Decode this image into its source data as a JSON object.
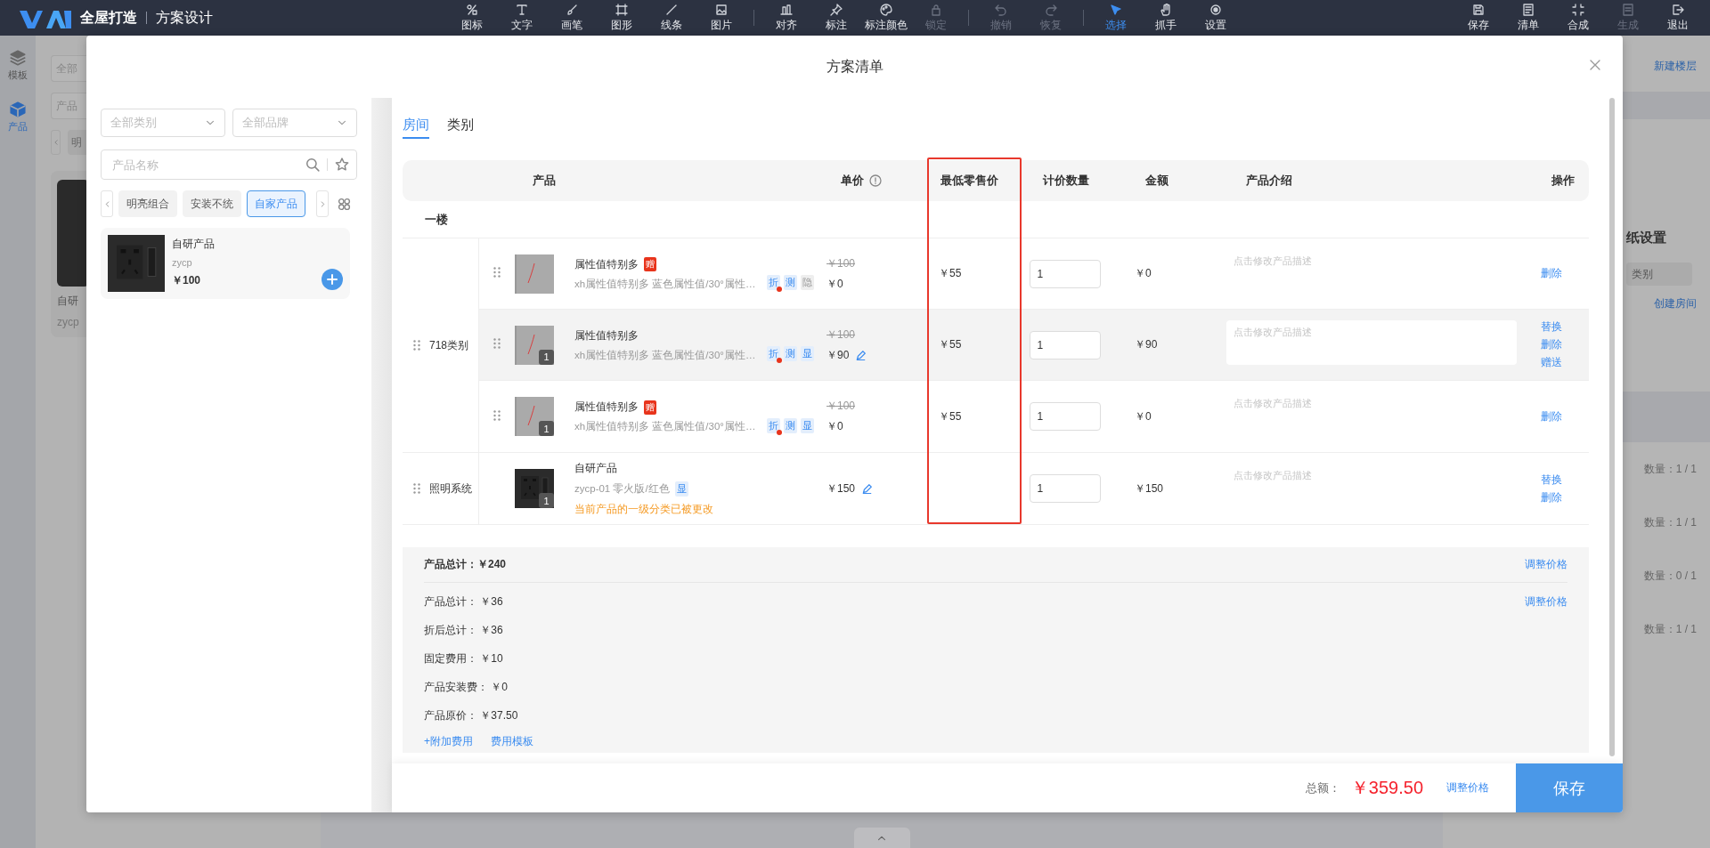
{
  "app_bar": {
    "brand": "全屋打造",
    "title": "方案设计",
    "tool_groups": [
      {
        "tools": [
          {
            "label": "图标",
            "disabled": false,
            "selected": false
          },
          {
            "label": "文字",
            "disabled": false,
            "selected": false
          },
          {
            "label": "画笔",
            "disabled": false,
            "selected": false
          },
          {
            "label": "图形",
            "disabled": false,
            "selected": false
          },
          {
            "label": "线条",
            "disabled": false,
            "selected": false
          },
          {
            "label": "图片",
            "disabled": false,
            "selected": false
          }
        ]
      },
      {
        "tools": [
          {
            "label": "对齐",
            "disabled": false,
            "selected": false
          },
          {
            "label": "标注",
            "disabled": false,
            "selected": false
          },
          {
            "label": "标注颜色",
            "disabled": false,
            "selected": false
          },
          {
            "label": "锁定",
            "disabled": true,
            "selected": false
          }
        ]
      },
      {
        "tools": [
          {
            "label": "撤销",
            "disabled": true,
            "selected": false
          },
          {
            "label": "恢复",
            "disabled": true,
            "selected": false
          }
        ]
      },
      {
        "tools": [
          {
            "label": "选择",
            "disabled": false,
            "selected": true
          },
          {
            "label": "抓手",
            "disabled": false,
            "selected": false
          },
          {
            "label": "设置",
            "disabled": false,
            "selected": false
          }
        ]
      }
    ],
    "actions": [
      {
        "label": "保存",
        "disabled": false
      },
      {
        "label": "清单",
        "disabled": false
      },
      {
        "label": "合成",
        "disabled": false
      },
      {
        "label": "生成",
        "disabled": true
      },
      {
        "label": "退出",
        "disabled": false
      }
    ]
  },
  "side_rail": [
    {
      "label": "模板",
      "selected": false
    },
    {
      "label": "产品",
      "selected": true
    }
  ],
  "back_panel": {
    "category_placeholder": "全部",
    "search_placeholder": "产品",
    "tag": "明",
    "product_name": "自研",
    "product_code": "zycp"
  },
  "right_panel": {
    "new_floor": "新建楼层",
    "section_title": "纸设置",
    "field_placeholder": "类别",
    "create_room": "创建房间",
    "counts": [
      "数量：1 / 1",
      "数量：1 / 1",
      "数量：0 / 1",
      "数量：1 / 1"
    ]
  },
  "dialog": {
    "title": "方案清单",
    "picker": {
      "category_select": {
        "placeholder": "全部类别"
      },
      "brand_select": {
        "placeholder": "全部品牌"
      },
      "search": {
        "placeholder": "产品名称"
      },
      "tags": [
        {
          "label": "明亮组合",
          "selected": false
        },
        {
          "label": "安装不统",
          "selected": false
        },
        {
          "label": "自家产品",
          "selected": true
        }
      ],
      "product": {
        "name": "自研产品",
        "code": "zycp",
        "price": "￥100"
      }
    },
    "tabs": [
      {
        "label": "房间",
        "selected": true
      },
      {
        "label": "类别",
        "selected": false
      }
    ],
    "table": {
      "columns": [
        {
          "label": "产品",
          "info": false
        },
        {
          "label": "单价",
          "info": true
        },
        {
          "label": "最低零售价",
          "info": false
        },
        {
          "label": "计价数量",
          "info": false
        },
        {
          "label": "金额",
          "info": false
        },
        {
          "label": "产品介绍",
          "info": false
        },
        {
          "label": "操作",
          "info": false
        }
      ],
      "floor": "一楼",
      "groups": [
        {
          "name": "718类别",
          "items": [
            {
              "kind": "variant",
              "draggable": true,
              "hovered": false,
              "name": "属性值特别多",
              "badge": "赠",
              "spec": "xh属性值特别多 蓝色属性值/30°属性…",
              "tags": [
                {
                  "label": "折",
                  "kind": "split"
                },
                {
                  "label": "测",
                  "kind": "info"
                },
                {
                  "label": "隐",
                  "kind": "muted"
                }
              ],
              "list_price": "￥100",
              "price": "￥0",
              "price_editable": false,
              "min_price": "￥55",
              "quantity": "1",
              "amount": "￥0",
              "description": {
                "placeholder": "点击修改产品描述"
              },
              "actions": [
                "删除"
              ]
            },
            {
              "kind": "variant",
              "draggable": true,
              "hovered": true,
              "name": "属性值特别多",
              "count": "1",
              "spec": "xh属性值特别多 蓝色属性值/30°属性…",
              "tags": [
                {
                  "label": "折",
                  "kind": "split"
                },
                {
                  "label": "测",
                  "kind": "info"
                },
                {
                  "label": "显",
                  "kind": "info"
                }
              ],
              "list_price": "￥100",
              "price": "￥90",
              "price_editable": true,
              "min_price": "￥55",
              "quantity": "1",
              "amount": "￥90",
              "description": {
                "placeholder": "点击修改产品描述"
              },
              "actions": [
                "替换",
                "删除",
                "赠送"
              ]
            },
            {
              "kind": "variant",
              "draggable": true,
              "hovered": false,
              "name": "属性值特别多",
              "badge": "赠",
              "count": "1",
              "spec": "xh属性值特别多 蓝色属性值/30°属性…",
              "tags": [
                {
                  "label": "折",
                  "kind": "split"
                },
                {
                  "label": "测",
                  "kind": "info"
                },
                {
                  "label": "显",
                  "kind": "info"
                }
              ],
              "list_price": "￥100",
              "price": "￥0",
              "price_editable": false,
              "min_price": "￥55",
              "quantity": "1",
              "amount": "￥0",
              "description": {
                "placeholder": "点击修改产品描述"
              },
              "actions": [
                "删除"
              ]
            }
          ]
        },
        {
          "name": "照明系统",
          "items": [
            {
              "kind": "custom",
              "draggable": false,
              "hovered": false,
              "name": "自研产品",
              "count": "1",
              "spec": "zycp-01 零火版/红色",
              "tags": [
                {
                  "label": "显",
                  "kind": "info"
                }
              ],
              "warning": "当前产品的一级分类已被更改",
              "price": "￥150",
              "price_editable": true,
              "quantity": "1",
              "amount": "￥150",
              "description": {
                "placeholder": "点击修改产品描述"
              },
              "actions": [
                "替换",
                "删除"
              ]
            }
          ]
        }
      ]
    },
    "summary": {
      "total": "产品总计：￥240",
      "total_action": "调整价格",
      "lines": [
        {
          "label": "产品总计：",
          "value": "￥36",
          "action": "调整价格"
        },
        {
          "label": "折后总计：",
          "value": "￥36"
        },
        {
          "label": "固定费用：",
          "value": "￥10"
        },
        {
          "label": "产品安装费：",
          "value": "￥0"
        },
        {
          "label": "产品原价：",
          "value": "￥37.50"
        }
      ],
      "links": [
        "+附加费用",
        "费用模板"
      ]
    },
    "footer": {
      "total_label": "总额：",
      "total": "￥359.50",
      "adjust": "调整价格",
      "save": "保存"
    }
  }
}
